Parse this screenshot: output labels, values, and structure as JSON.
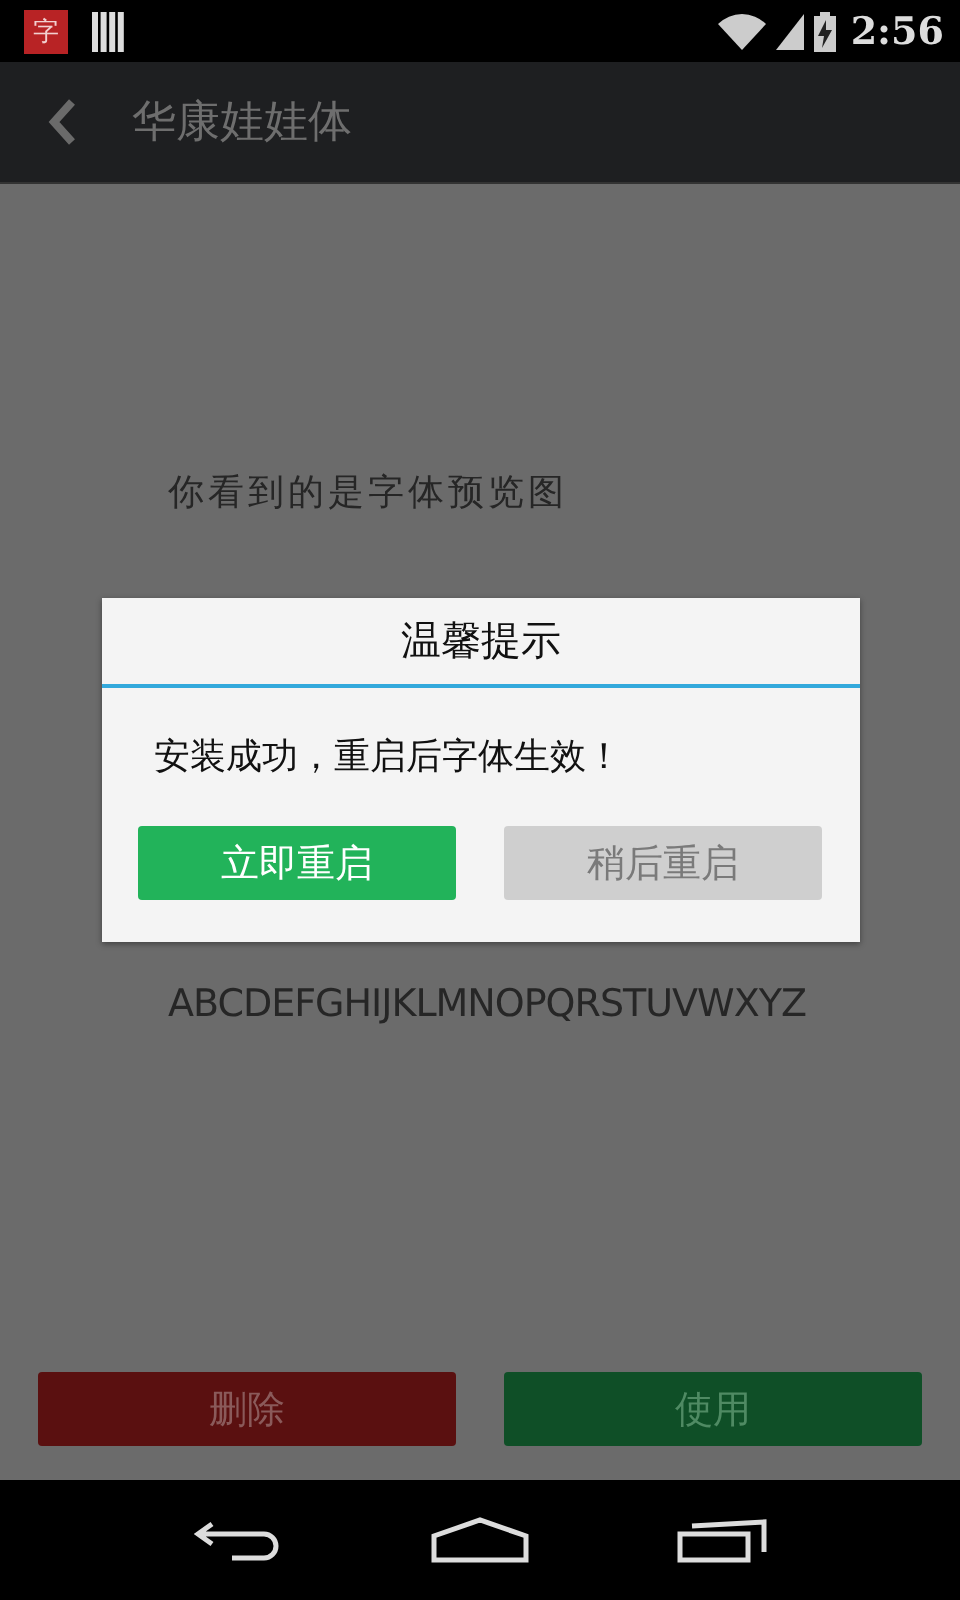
{
  "status_bar": {
    "app_badge": "字",
    "time": "2:56"
  },
  "app_bar": {
    "title": "华康娃娃体"
  },
  "preview": {
    "lines": [
      {
        "text": "你看到的是字体预览图",
        "kind": "caption"
      },
      {
        "text": "ABCDEFGHIJKLMNOPQRSTUVWXYZ",
        "kind": "alphabet"
      }
    ]
  },
  "actions": [
    {
      "label": "删除",
      "kind": "delete"
    },
    {
      "label": "使用",
      "kind": "use"
    }
  ],
  "dialog": {
    "title": "温馨提示",
    "message": "安装成功，重启后字体生效！",
    "buttons": [
      {
        "label": "立即重启",
        "kind": "primary"
      },
      {
        "label": "稍后重启",
        "kind": "secondary"
      }
    ]
  }
}
